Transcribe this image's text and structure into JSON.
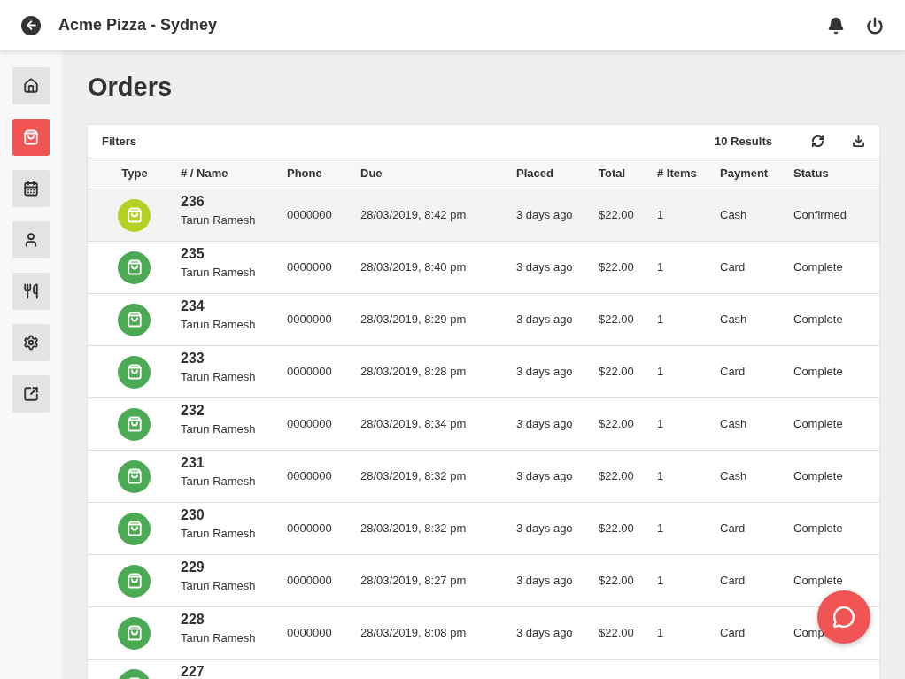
{
  "header": {
    "title": "Acme Pizza - Sydney"
  },
  "sidebar": {
    "items": [
      {
        "selected": false
      },
      {
        "selected": true
      },
      {
        "selected": false
      },
      {
        "selected": false
      },
      {
        "selected": false
      },
      {
        "selected": false
      },
      {
        "selected": false
      }
    ]
  },
  "page_title": "Orders",
  "toolbar": {
    "filters": "Filters",
    "results": "10 Results"
  },
  "table": {
    "columns": [
      "Type",
      "# / Name",
      "Phone",
      "Due",
      "Placed",
      "Total",
      "# Items",
      "Payment",
      "Status"
    ],
    "rows": [
      {
        "selected": true,
        "color": "#b5cf23",
        "number": "236",
        "name": "Tarun Ramesh",
        "phone": "0000000",
        "due": "28/03/2019, 8:42 pm",
        "placed": "3 days ago",
        "total": "$22.00",
        "items": "1",
        "payment": "Cash",
        "status": "Confirmed"
      },
      {
        "selected": false,
        "color": "#4caa55",
        "number": "235",
        "name": "Tarun Ramesh",
        "phone": "0000000",
        "due": "28/03/2019, 8:40 pm",
        "placed": "3 days ago",
        "total": "$22.00",
        "items": "1",
        "payment": "Card",
        "status": "Complete"
      },
      {
        "selected": false,
        "color": "#4caa55",
        "number": "234",
        "name": "Tarun Ramesh",
        "phone": "0000000",
        "due": "28/03/2019, 8:29 pm",
        "placed": "3 days ago",
        "total": "$22.00",
        "items": "1",
        "payment": "Cash",
        "status": "Complete"
      },
      {
        "selected": false,
        "color": "#4caa55",
        "number": "233",
        "name": "Tarun Ramesh",
        "phone": "0000000",
        "due": "28/03/2019, 8:28 pm",
        "placed": "3 days ago",
        "total": "$22.00",
        "items": "1",
        "payment": "Card",
        "status": "Complete"
      },
      {
        "selected": false,
        "color": "#4caa55",
        "number": "232",
        "name": "Tarun Ramesh",
        "phone": "0000000",
        "due": "28/03/2019, 8:34 pm",
        "placed": "3 days ago",
        "total": "$22.00",
        "items": "1",
        "payment": "Cash",
        "status": "Complete"
      },
      {
        "selected": false,
        "color": "#4caa55",
        "number": "231",
        "name": "Tarun Ramesh",
        "phone": "0000000",
        "due": "28/03/2019, 8:32 pm",
        "placed": "3 days ago",
        "total": "$22.00",
        "items": "1",
        "payment": "Cash",
        "status": "Complete"
      },
      {
        "selected": false,
        "color": "#4caa55",
        "number": "230",
        "name": "Tarun Ramesh",
        "phone": "0000000",
        "due": "28/03/2019, 8:32 pm",
        "placed": "3 days ago",
        "total": "$22.00",
        "items": "1",
        "payment": "Card",
        "status": "Complete"
      },
      {
        "selected": false,
        "color": "#4caa55",
        "number": "229",
        "name": "Tarun Ramesh",
        "phone": "0000000",
        "due": "28/03/2019, 8:27 pm",
        "placed": "3 days ago",
        "total": "$22.00",
        "items": "1",
        "payment": "Card",
        "status": "Complete"
      },
      {
        "selected": false,
        "color": "#4caa55",
        "number": "228",
        "name": "Tarun Ramesh",
        "phone": "0000000",
        "due": "28/03/2019, 8:08 pm",
        "placed": "3 days ago",
        "total": "$22.00",
        "items": "1",
        "payment": "Card",
        "status": "Comp"
      },
      {
        "selected": false,
        "color": "#4caa55",
        "number": "227"
      }
    ]
  }
}
